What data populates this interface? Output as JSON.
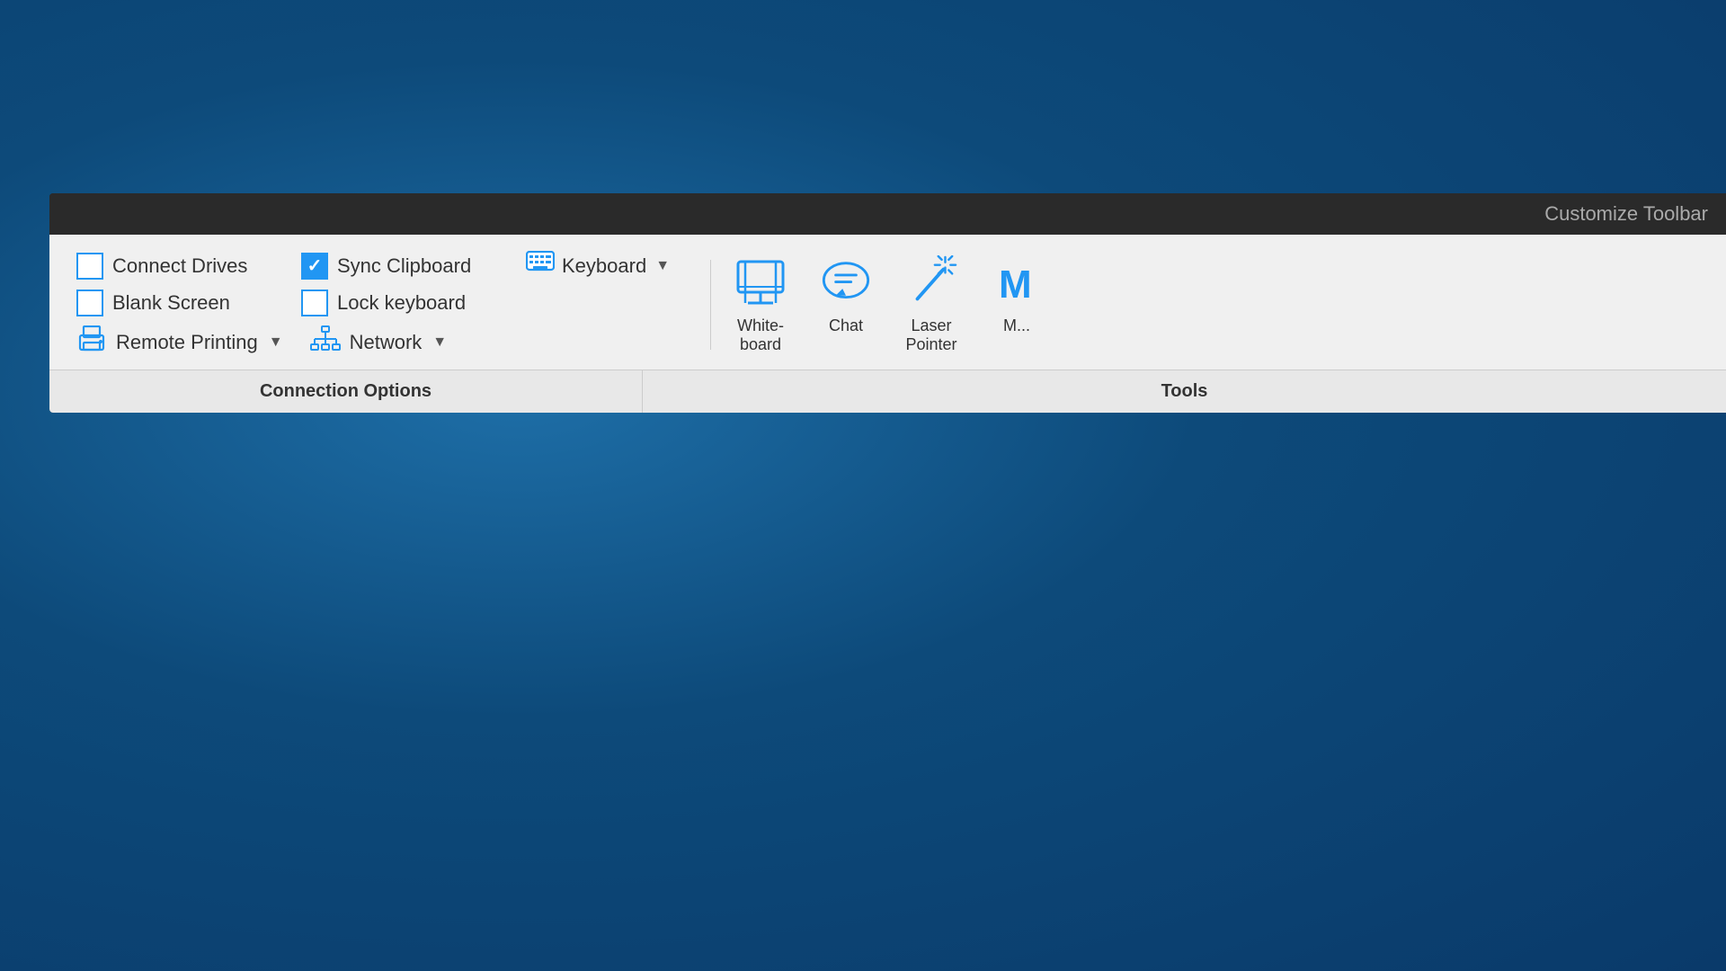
{
  "toolbar": {
    "customize_label": "Customize Toolbar",
    "connection_options": {
      "label": "Connection Options",
      "items": [
        {
          "id": "connect-drives",
          "type": "checkbox",
          "label": "Connect Drives",
          "checked": false
        },
        {
          "id": "blank-screen",
          "type": "checkbox",
          "label": "Blank Screen",
          "checked": false
        },
        {
          "id": "sync-clipboard",
          "type": "checkbox",
          "label": "Sync Clipboard",
          "checked": true
        },
        {
          "id": "lock-keyboard",
          "type": "checkbox",
          "label": "Lock keyboard",
          "checked": false
        },
        {
          "id": "remote-printing",
          "type": "dropdown",
          "label": "Remote Printing"
        },
        {
          "id": "network",
          "type": "dropdown",
          "label": "Network"
        },
        {
          "id": "keyboard",
          "type": "dropdown",
          "label": "Keyboard"
        }
      ]
    },
    "tools": {
      "label": "Tools",
      "items": [
        {
          "id": "whiteboard",
          "label": "White-\nboard"
        },
        {
          "id": "chat",
          "label": "Chat"
        },
        {
          "id": "laser-pointer",
          "label": "Laser\nPointer"
        },
        {
          "id": "more",
          "label": "M..."
        }
      ]
    }
  }
}
